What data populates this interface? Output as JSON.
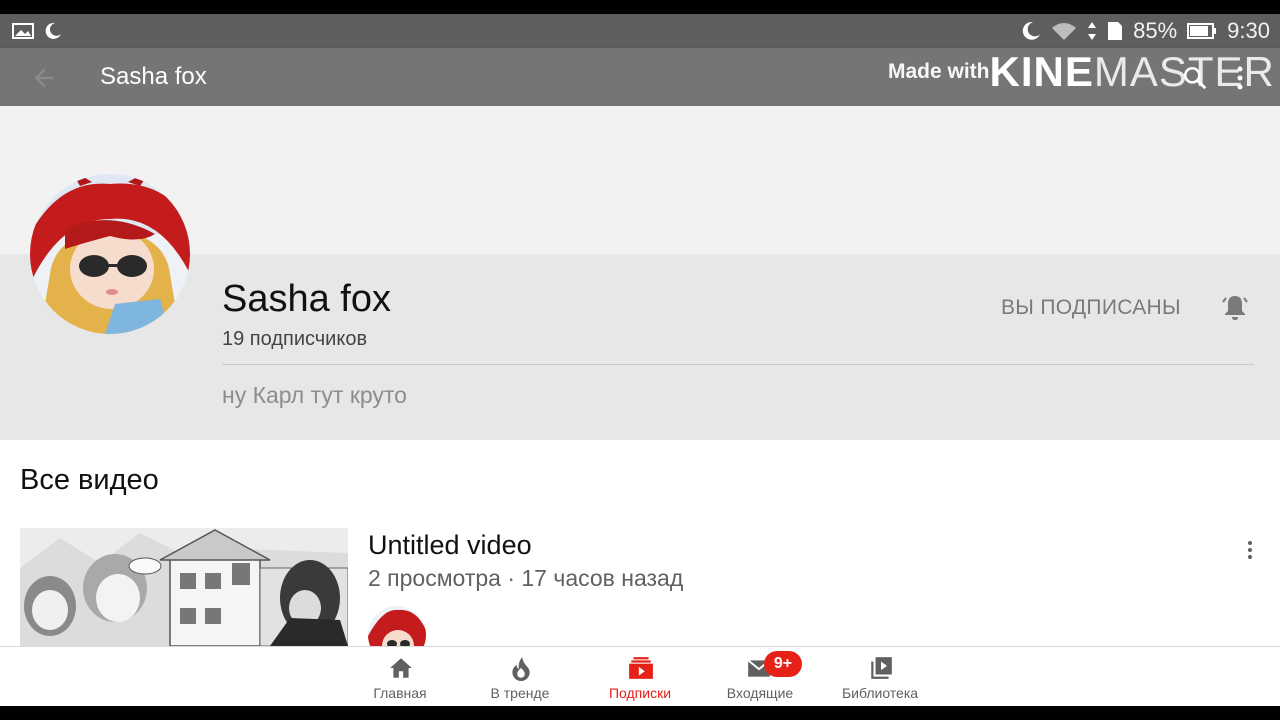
{
  "status_bar": {
    "battery": "85%",
    "time": "9:30"
  },
  "app_bar": {
    "title": "Sasha fox"
  },
  "watermark": {
    "made_with": "Made with",
    "brand_bold": "KINE",
    "brand_light": "MASTER"
  },
  "channel": {
    "name": "Sasha fox",
    "subscribers": "19 подписчиков",
    "subscribed_label": "ВЫ ПОДПИСАНЫ",
    "description": "ну Карл тут круто"
  },
  "videos_section": {
    "title": "Все видео",
    "items": [
      {
        "title": "Untitled video",
        "meta": "2 просмотра · 17 часов назад"
      }
    ]
  },
  "bottom_nav": {
    "items": [
      {
        "label": "Главная",
        "icon": "home-icon"
      },
      {
        "label": "В тренде",
        "icon": "trending-icon"
      },
      {
        "label": "Подписки",
        "icon": "subscriptions-icon",
        "active": true
      },
      {
        "label": "Входящие",
        "icon": "inbox-icon",
        "badge": "9+"
      },
      {
        "label": "Библиотека",
        "icon": "library-icon"
      }
    ]
  },
  "colors": {
    "accent": "#e62117",
    "app_bar": "#757575",
    "status_bar": "#5e5e5e",
    "channel_bg": "#e7e7e7"
  }
}
